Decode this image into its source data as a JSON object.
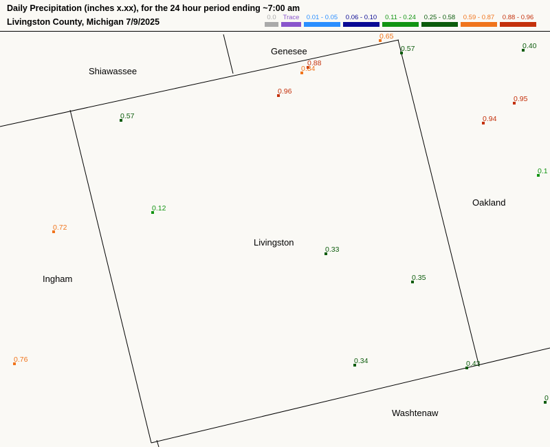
{
  "header": {
    "title_line1": "Daily Precipitation (inches  x.xx),  for the 24 hour period ending ~7:00 am",
    "title_line2": "Livingston County, Michigan  7/9/2025"
  },
  "legend": [
    {
      "label": "0.0",
      "color": "#aaaaaa"
    },
    {
      "label": "Trace",
      "color": "#8a56cc"
    },
    {
      "label": "0.01 - 0.05",
      "color": "#2b8fff"
    },
    {
      "label": "0.06 - 0.10",
      "color": "#0a0a94"
    },
    {
      "label": "0.11 - 0.24",
      "color": "#129412"
    },
    {
      "label": "0.25 - 0.58",
      "color": "#0c5c0c"
    },
    {
      "label": "0.59 - 0.87",
      "color": "#f0741c"
    },
    {
      "label": "0.88 - 0.96",
      "color": "#c4310c"
    }
  ],
  "counties": [
    "Shiawassee",
    "Genesee",
    "Livingston",
    "Oakland",
    "Ingham",
    "Washtenaw"
  ],
  "stations": [
    {
      "value": "0.65",
      "category": 6
    },
    {
      "value": "0.57",
      "category": 5
    },
    {
      "value": "0.40",
      "category": 5
    },
    {
      "value": "0.88",
      "category": 7
    },
    {
      "value": "0.84",
      "category": 6
    },
    {
      "value": "0.96",
      "category": 7
    },
    {
      "value": "0.95",
      "category": 7
    },
    {
      "value": "0.94",
      "category": 7
    },
    {
      "value": "0.57",
      "category": 5
    },
    {
      "value": "0.1",
      "category": 4
    },
    {
      "value": "0.12",
      "category": 4
    },
    {
      "value": "0.72",
      "category": 6
    },
    {
      "value": "0.33",
      "category": 5
    },
    {
      "value": "0.35",
      "category": 5
    },
    {
      "value": "0.76",
      "category": 6
    },
    {
      "value": "0.34",
      "category": 5
    },
    {
      "value": "0.43",
      "category": 5
    },
    {
      "value": "0",
      "category": 5
    }
  ]
}
